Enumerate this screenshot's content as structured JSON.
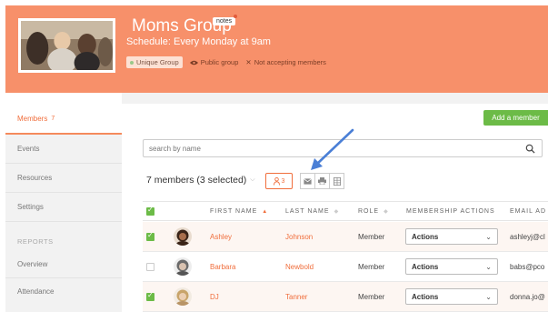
{
  "group": {
    "title": "Moms Group",
    "notes_tag": "notes",
    "schedule": "Schedule: Every Monday at 9am",
    "unique_badge": "Unique Group",
    "visibility": "Public group",
    "accepting": "Not accepting members"
  },
  "sidebar": {
    "items": [
      {
        "label": "Members",
        "count": "7"
      },
      {
        "label": "Events"
      },
      {
        "label": "Resources"
      },
      {
        "label": "Settings"
      }
    ],
    "reports_heading": "REPORTS",
    "report_items": [
      {
        "label": "Overview"
      },
      {
        "label": "Attendance"
      }
    ]
  },
  "toolbar": {
    "add_member": "Add a member",
    "search_placeholder": "search by name",
    "members_count": "7 members (3 selected)",
    "selected_count": "3"
  },
  "table": {
    "headers": {
      "first_name": "FIRST NAME",
      "last_name": "LAST NAME",
      "role": "ROLE",
      "actions": "MEMBERSHIP ACTIONS",
      "email": "EMAIL AD"
    },
    "rows": [
      {
        "first": "Ashley",
        "last": "Johnson",
        "role": "Member",
        "action": "Actions",
        "email": "ashleyj@cl",
        "checked": true
      },
      {
        "first": "Barbara",
        "last": "Newbold",
        "role": "Member",
        "action": "Actions",
        "email": "babs@pco",
        "checked": false
      },
      {
        "first": "DJ",
        "last": "Tanner",
        "role": "Member",
        "action": "Actions",
        "email": "donna.jo@",
        "checked": true
      }
    ]
  },
  "colors": {
    "banner": "#f7906a",
    "accent": "#f06e3c",
    "add_button": "#6cbb47",
    "arrow": "#4a7fd6"
  }
}
